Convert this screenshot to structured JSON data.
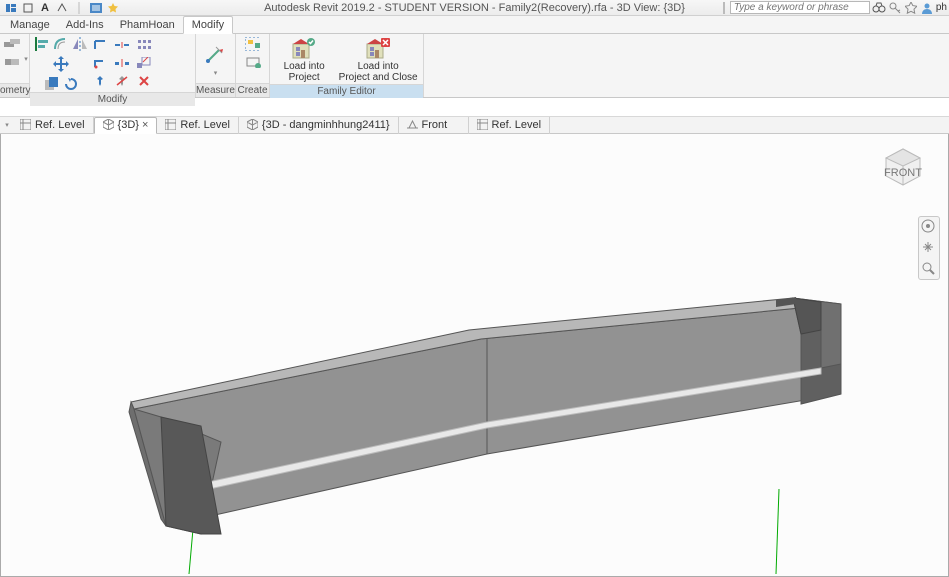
{
  "app_title": "Autodesk Revit 2019.2 - STUDENT VERSION - Family2(Recovery).rfa - 3D View: {3D}",
  "search_placeholder": "Type a keyword or phrase",
  "username_initial": "ph",
  "ribbon_tabs": {
    "manage": "Manage",
    "addins": "Add-Ins",
    "phamhoan": "PhamHoan",
    "modify": "Modify"
  },
  "panels": {
    "geometry": "ometry",
    "modify": "Modify",
    "measure": "Measure",
    "create": "Create",
    "family_editor": "Family Editor"
  },
  "buttons": {
    "load_project_l1": "Load into",
    "load_project_l2": "Project",
    "load_close_l1": "Load into",
    "load_close_l2": "Project and Close"
  },
  "view_tabs": {
    "t1": "Ref. Level",
    "t2": "{3D}",
    "t3": "Ref. Level",
    "t4": "{3D - dangminhhung2411}",
    "t5": "Front",
    "t6": "Ref. Level"
  },
  "viewcube_face": "FRONT"
}
